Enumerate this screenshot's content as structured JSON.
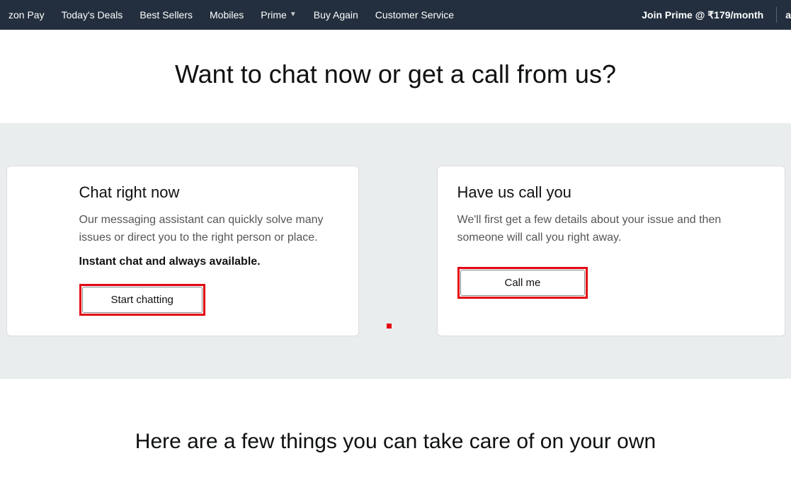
{
  "nav": {
    "items": [
      "zon Pay",
      "Today's Deals",
      "Best Sellers",
      "Mobiles",
      "Prime",
      "Buy Again",
      "Customer Service"
    ],
    "prime_cta": "Join Prime @ ₹179/month",
    "brand_fragment": "a"
  },
  "heading": "Want to chat now or get a call from us?",
  "cards": {
    "chat": {
      "title": "Chat right now",
      "desc": "Our messaging assistant can quickly solve many issues or direct you to the right person or place.",
      "strong": "Instant chat and always available.",
      "button": "Start chatting"
    },
    "call": {
      "title": "Have us call you",
      "desc": "We'll first get a few details about your issue and then someone will call you right away.",
      "button": "Call me"
    }
  },
  "sub_heading": "Here are a few things you can take care of on your own"
}
